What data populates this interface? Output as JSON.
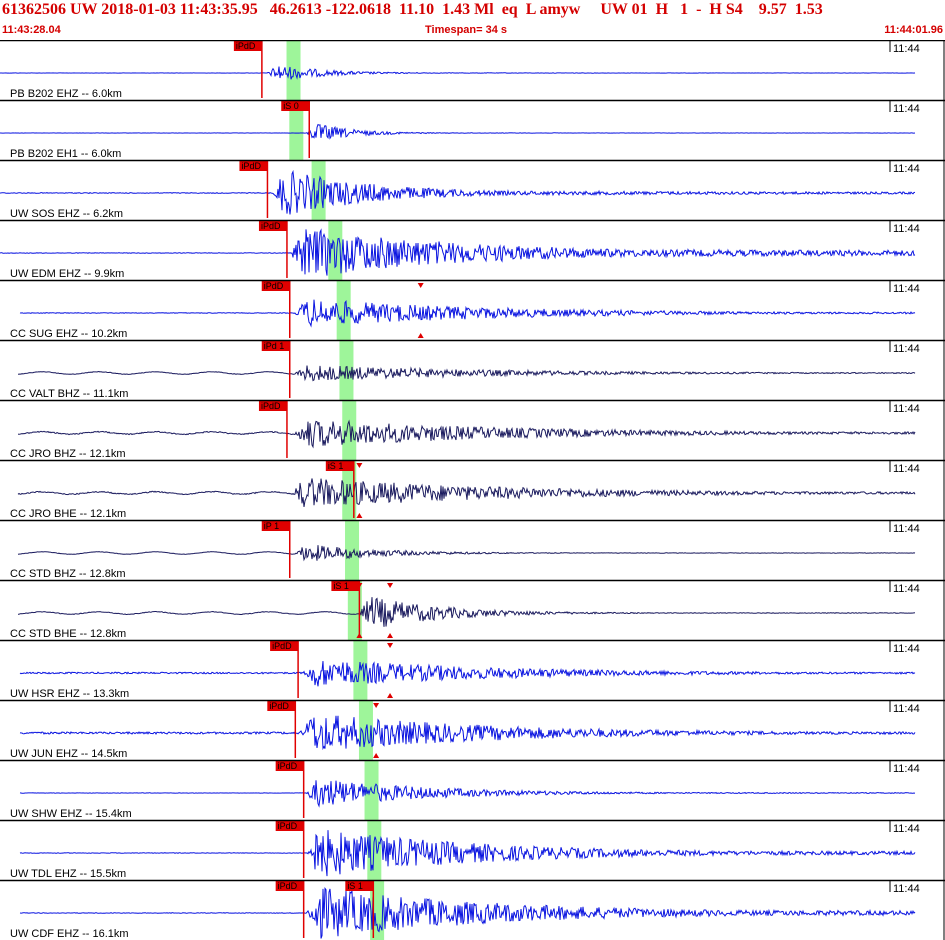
{
  "header": {
    "event_line": "61362506 UW 2018-01-03 11:43:35.95   46.2613 -122.0618  11.10  1.43 Ml  eq  L amyw     UW 01  H   1  -  H S4    9.57  1.53",
    "start_time": "11:43:28.04",
    "timespan": "Timespan=  34 s",
    "end_time": "11:44:01.96"
  },
  "colors": {
    "header_text": "#d40000",
    "trace_blue": "#0a14e0",
    "trace_navy": "#1a1a5e",
    "pick_red": "#e00000",
    "window_green": "#9ef59a",
    "border": "#000000"
  },
  "panel_time_label": "11:44",
  "traces": [
    {
      "label": "PB B202 EHZ -- 6.0km",
      "color": "blue",
      "picks": [
        {
          "text": "iPdD",
          "t": 9.4
        }
      ],
      "s_window": 10.5,
      "onset": 9.6,
      "amplitude": 0.38,
      "duration": 5,
      "noise": 0.01,
      "late": 0.05
    },
    {
      "label": "PB B202 EH1 -- 6.0km",
      "color": "blue",
      "picks": [
        {
          "text": "iS 0",
          "t": 11.1
        }
      ],
      "s_window": 10.6,
      "onset": 11.0,
      "amplitude": 0.45,
      "duration": 4,
      "noise": 0.01,
      "late": 0.04
    },
    {
      "label": "UW SOS EHZ -- 6.2km",
      "color": "blue",
      "picks": [
        {
          "text": "iPdD",
          "t": 9.6
        }
      ],
      "s_window": 11.4,
      "onset": 9.8,
      "amplitude": 0.95,
      "duration": 10,
      "noise": 0.015,
      "late": 0.12
    },
    {
      "label": "UW EDM EHZ -- 9.9km",
      "color": "blue",
      "picks": [
        {
          "text": "iPdD",
          "t": 10.3
        }
      ],
      "s_window": 12.0,
      "onset": 10.5,
      "amplitude": 1.0,
      "duration": 18,
      "noise": 0.01,
      "late": 0.18
    },
    {
      "label": "CC SUG EHZ -- 10.2km",
      "color": "blue",
      "picks": [
        {
          "text": "iPdD",
          "t": 10.4
        }
      ],
      "s_window": 12.3,
      "onset": 10.6,
      "amplitude": 0.55,
      "duration": 20,
      "noise": 0.02,
      "late": 0.1,
      "markers": [
        15.1
      ]
    },
    {
      "label": "CC VALT BHZ -- 11.1km",
      "color": "navy",
      "picks": [
        {
          "text": "iPd 1",
          "t": 10.4
        }
      ],
      "s_window": 12.4,
      "onset": 10.6,
      "amplitude": 0.32,
      "duration": 20,
      "noise": 0.03,
      "late": 0.1
    },
    {
      "label": "CC JRO BHZ -- 12.1km",
      "color": "navy",
      "picks": [
        {
          "text": "iPdD",
          "t": 10.3
        }
      ],
      "s_window": 12.5,
      "onset": 10.6,
      "amplitude": 0.55,
      "duration": 22,
      "noise": 0.035,
      "late": 0.12
    },
    {
      "label": "CC JRO BHE -- 12.1km",
      "color": "navy",
      "picks": [
        {
          "text": "iS 1",
          "t": 12.7
        }
      ],
      "s_window": 12.5,
      "onset": 10.5,
      "amplitude": 0.6,
      "duration": 22,
      "noise": 0.035,
      "late": 0.12,
      "markers": [
        12.9
      ]
    },
    {
      "label": "CC STD BHZ -- 12.8km",
      "color": "navy",
      "picks": [
        {
          "text": "iP 1",
          "t": 10.4
        }
      ],
      "s_window": 12.6,
      "onset": 10.6,
      "amplitude": 0.38,
      "duration": 8,
      "noise": 0.02,
      "late": 0.04
    },
    {
      "label": "CC STD BHE -- 12.8km",
      "color": "navy",
      "picks": [
        {
          "text": "iS 1",
          "t": 12.9
        }
      ],
      "s_window": 12.7,
      "onset": 12.9,
      "amplitude": 0.7,
      "duration": 8,
      "noise": 0.015,
      "late": 0.03,
      "markers": [
        12.9,
        14.0
      ]
    },
    {
      "label": "UW HSR EHZ -- 13.3km",
      "color": "blue",
      "picks": [
        {
          "text": "iPdD",
          "t": 10.7
        }
      ],
      "s_window": 12.9,
      "onset": 10.9,
      "amplitude": 0.55,
      "duration": 20,
      "noise": 0.05,
      "late": 0.1,
      "markers": [
        14.0
      ]
    },
    {
      "label": "UW JUN EHZ -- 14.5km",
      "color": "blue",
      "picks": [
        {
          "text": "iPdD",
          "t": 10.6
        }
      ],
      "s_window": 13.1,
      "onset": 10.8,
      "amplitude": 0.75,
      "duration": 20,
      "noise": 0.05,
      "late": 0.1,
      "markers": [
        13.5
      ]
    },
    {
      "label": "UW SHW EHZ -- 15.4km",
      "color": "blue",
      "picks": [
        {
          "text": "iPdD",
          "t": 10.9
        }
      ],
      "s_window": 13.3,
      "onset": 11.0,
      "amplitude": 0.6,
      "duration": 12,
      "noise": 0.01,
      "late": 0.06
    },
    {
      "label": "UW TDL EHZ -- 15.5km",
      "color": "blue",
      "picks": [
        {
          "text": "iPdD",
          "t": 10.9
        }
      ],
      "s_window": 13.4,
      "onset": 11.0,
      "amplitude": 0.95,
      "duration": 18,
      "noise": 0.01,
      "late": 0.12
    },
    {
      "label": "UW CDF EHZ -- 16.1km",
      "color": "blue",
      "picks": [
        {
          "text": "iPdD",
          "t": 10.9
        },
        {
          "text": "iS 1",
          "t": 13.4
        }
      ],
      "s_window": 13.5,
      "onset": 11.0,
      "amplitude": 1.0,
      "duration": 20,
      "noise": 0.01,
      "late": 0.14
    }
  ]
}
